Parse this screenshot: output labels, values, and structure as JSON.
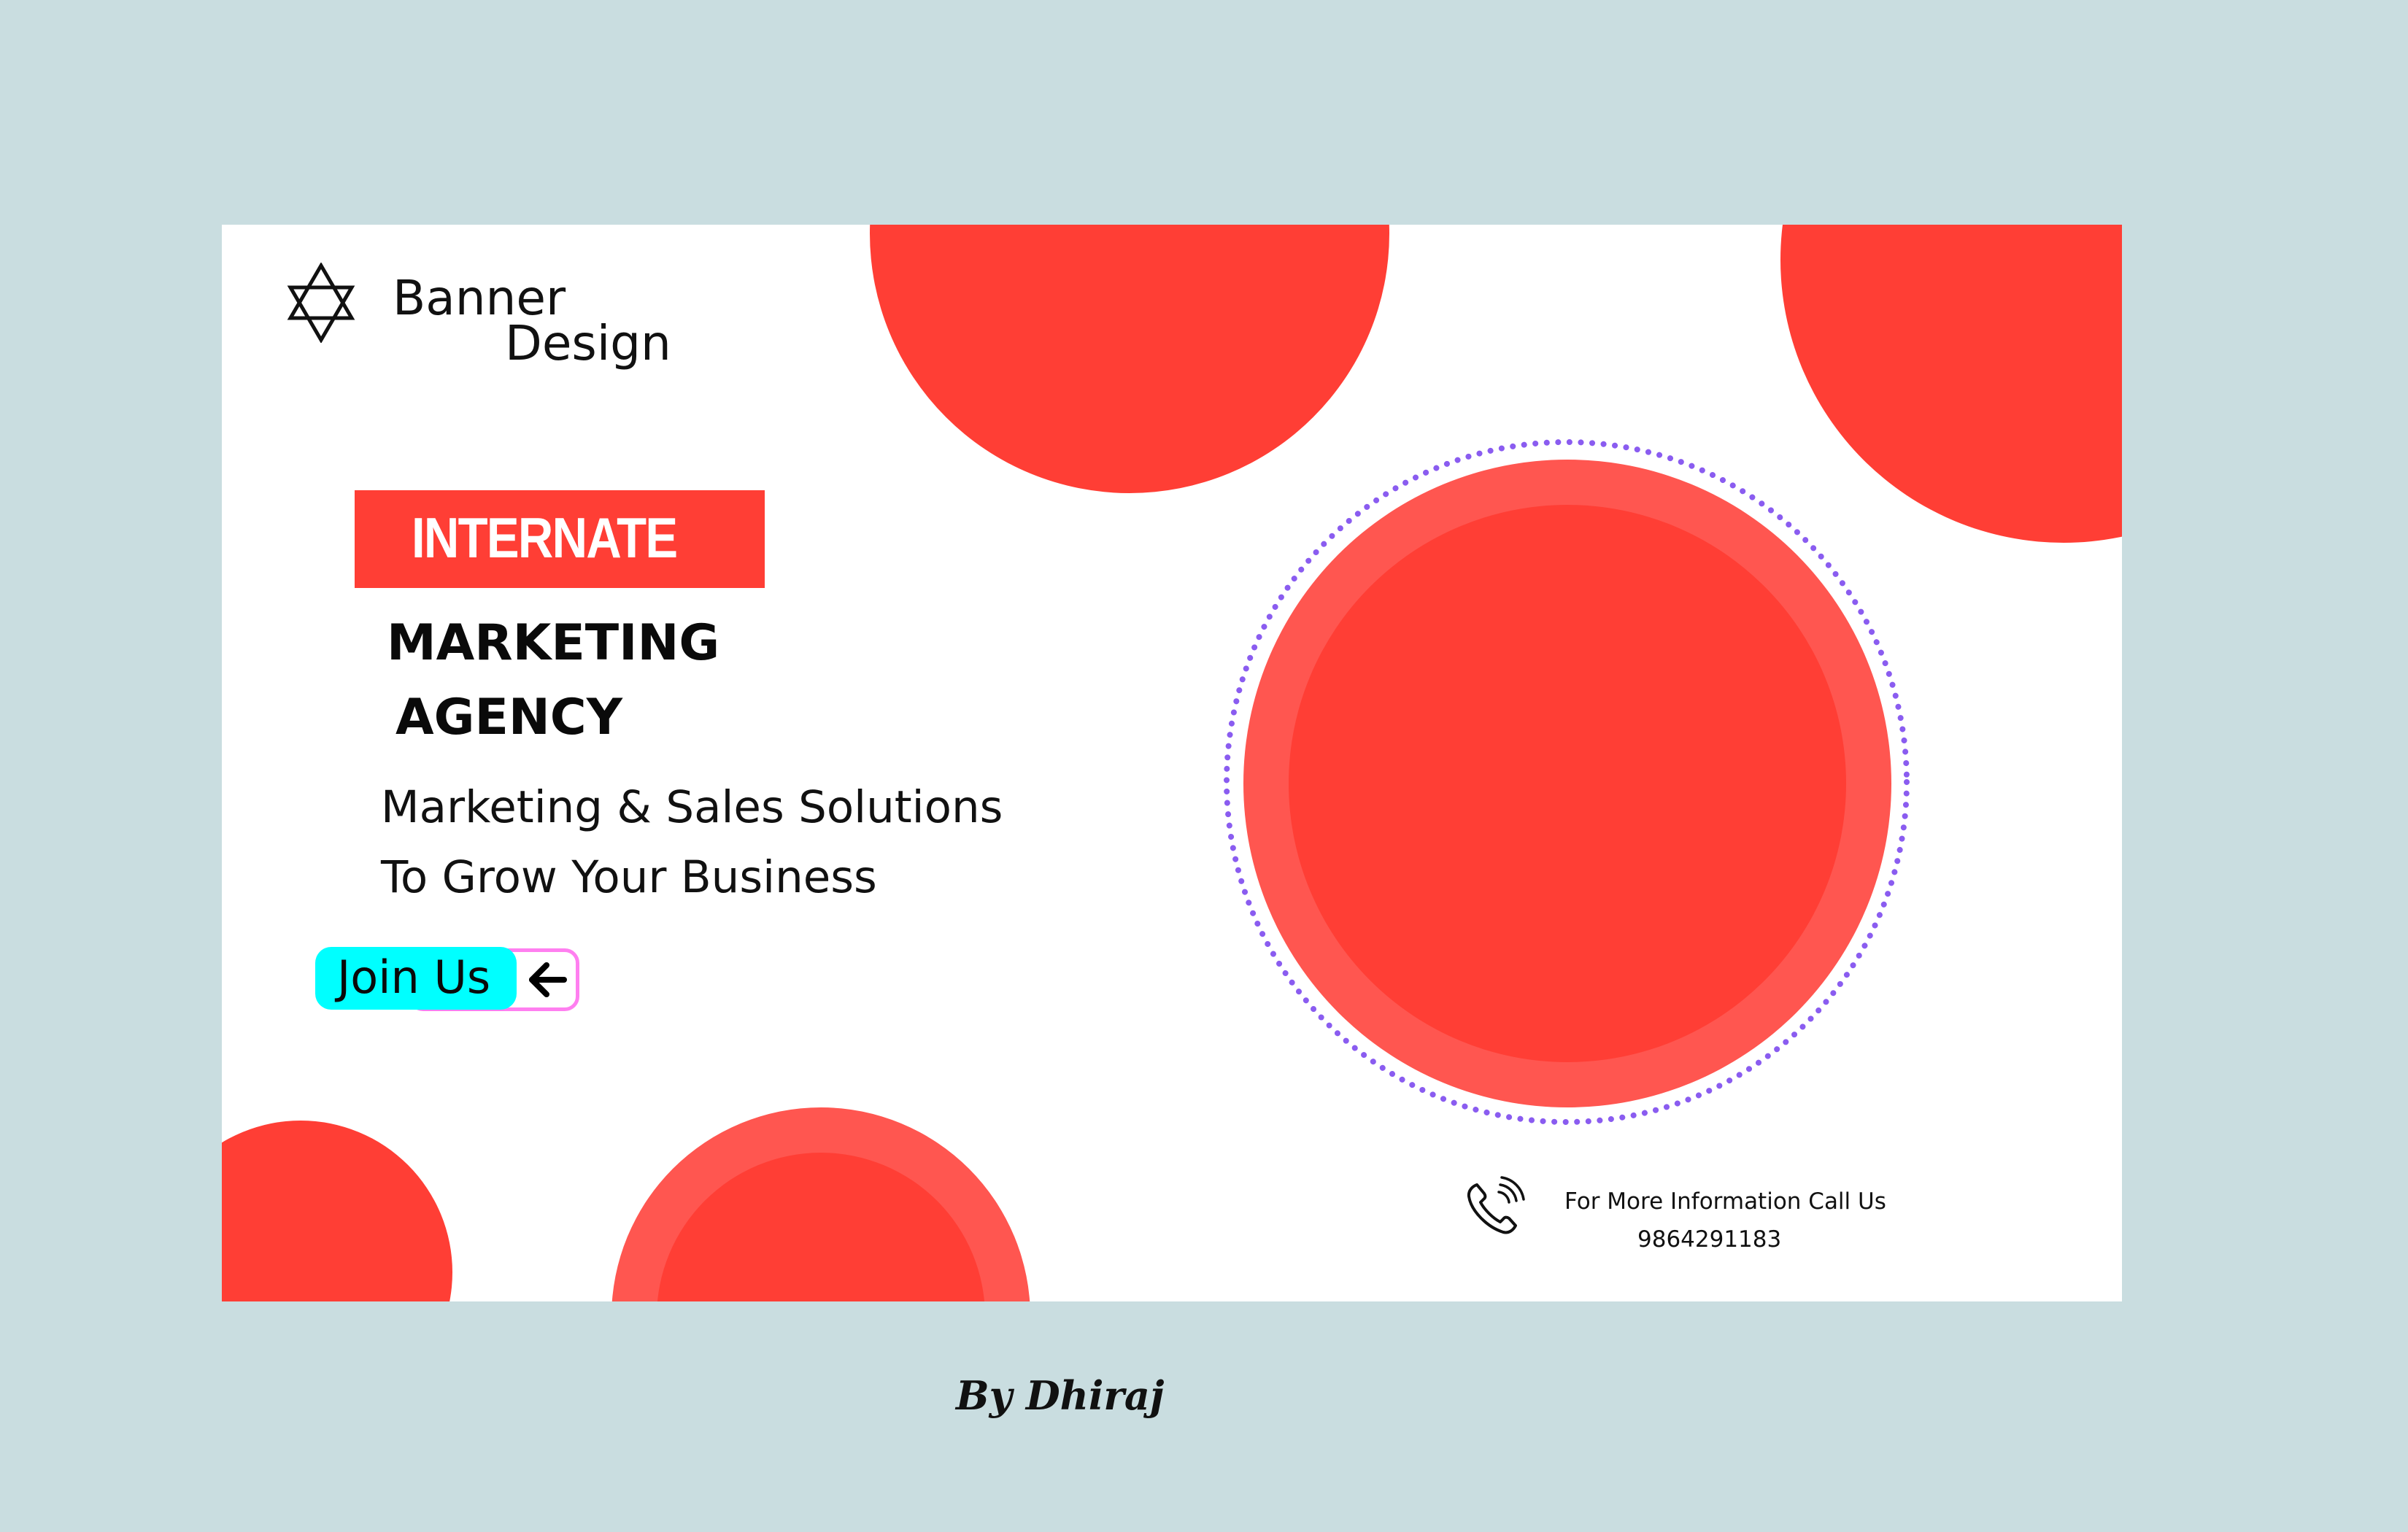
{
  "logo": {
    "icon": "star-of-david-icon",
    "line1": "Banner",
    "line2": "Design"
  },
  "tag": "INTERNATE",
  "headline": {
    "line1": "MARKETING",
    "line2": "AGENCY"
  },
  "subtitle": {
    "line1": "Marketing & Sales Solutions",
    "line2": "To Grow Your Business"
  },
  "cta": {
    "label": "Join Us",
    "icon": "arrow-left-icon"
  },
  "contact": {
    "icon": "phone-icon",
    "title": "For More Information Call Us",
    "number": "9864291183"
  },
  "credit": "By Dhiraj",
  "colors": {
    "background": "#c9dde0",
    "banner": "#ffffff",
    "accent_red": "#ff3e35",
    "accent_light_red": "#ff5650",
    "dots_purple": "#8a5cf0",
    "button_cyan": "#00ffff",
    "button_border_pink": "#ff7ff0"
  }
}
